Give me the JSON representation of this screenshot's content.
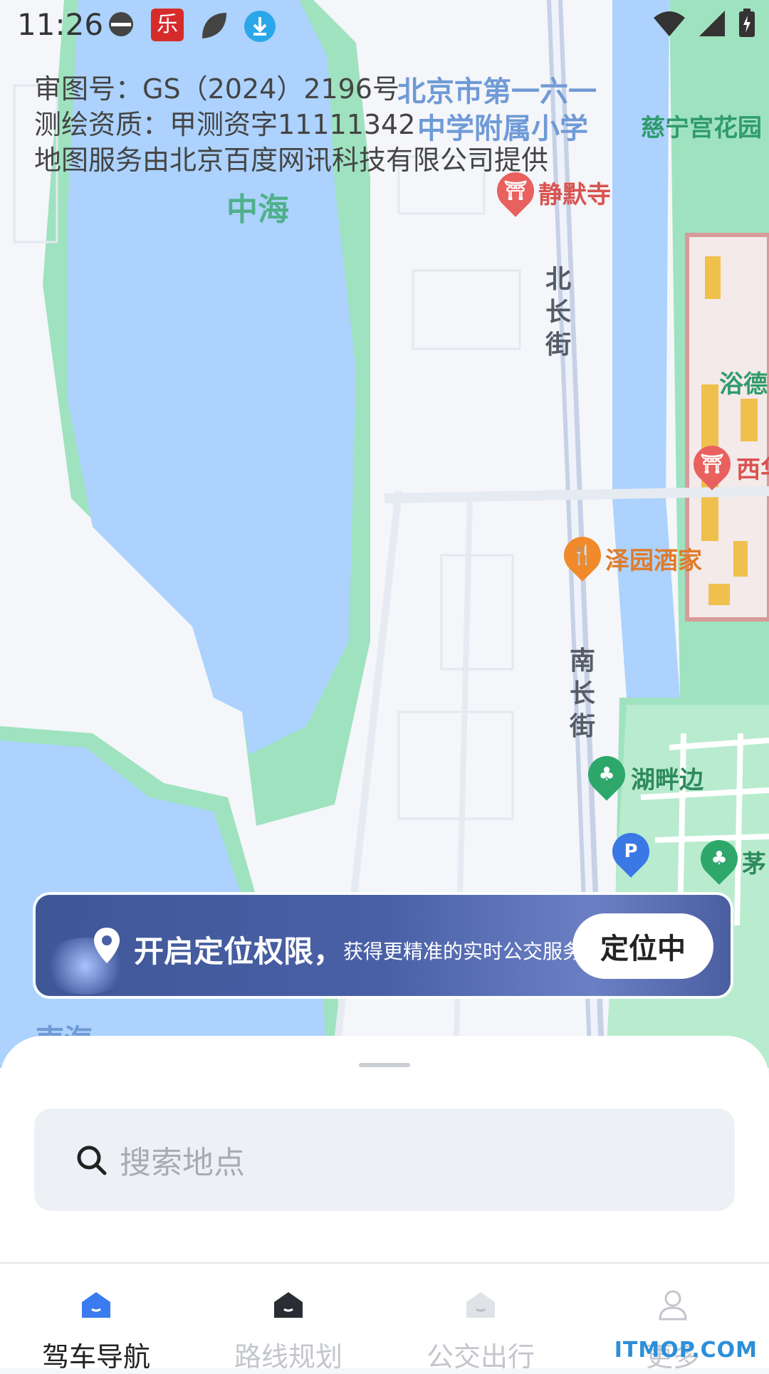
{
  "status_bar": {
    "time": "11:26"
  },
  "map": {
    "copyright_lines": [
      "审图号：GS（2024）2196号",
      "测绘资质：甲测资字11111342",
      "地图服务由北京百度网讯科技有限公司提供"
    ],
    "labels": {
      "school_line1": "北京市第一六一",
      "school_line2": "中学附属小学",
      "garden": "慈宁宫花园",
      "zhonghai": "中海",
      "temple": "静默寺",
      "road_north": "北长街",
      "road_south": "南长街",
      "yude": "浴德",
      "west": "西华",
      "restaurant": "泽园酒家",
      "lakeside": "湖畔边",
      "mao": "茅",
      "nanhai": "南海",
      "parking": "P"
    }
  },
  "banner": {
    "title": "开启定位权限，",
    "description": "获得更精准的实时公交服务",
    "button": "定位中"
  },
  "search": {
    "placeholder": "搜索地点"
  },
  "tabs": [
    {
      "label": "驾车导航",
      "active": true
    },
    {
      "label": "路线规划",
      "active": false
    },
    {
      "label": "公交出行",
      "active": false
    },
    {
      "label": "更多",
      "active": false
    }
  ],
  "colors": {
    "accent": "#3a7bf0",
    "water": "#acd2fd",
    "green": "#8fe0b3",
    "banner": "#4a60a6"
  },
  "watermark": "ITMOP.COM"
}
